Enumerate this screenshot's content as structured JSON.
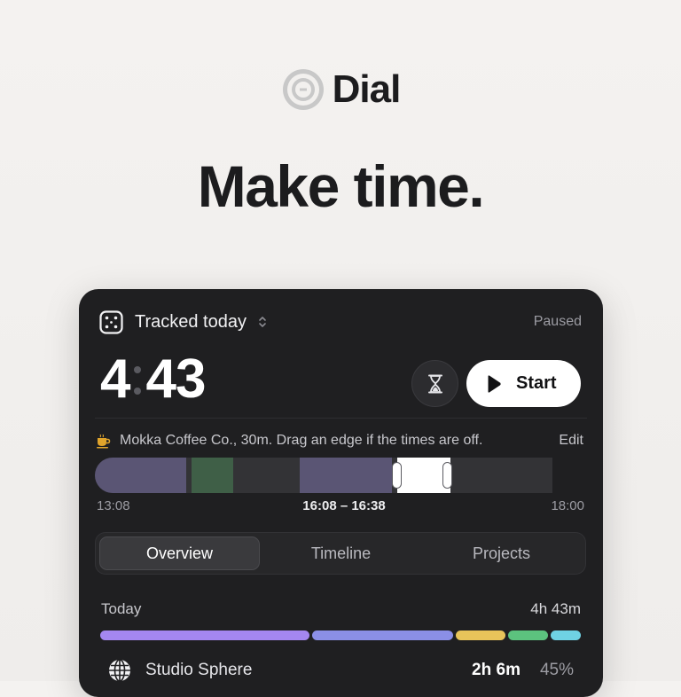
{
  "brand": {
    "name": "Dial"
  },
  "headline": "Make time.",
  "card": {
    "header": {
      "title": "Tracked today",
      "status": "Paused"
    },
    "timer": {
      "hours": "4",
      "minutes": "43"
    },
    "start_label": "Start",
    "entry": {
      "text": "Mokka Coffee Co., 30m. Drag an edge if the times are off.",
      "edit_label": "Edit"
    },
    "strip": {
      "start_time": "13:08",
      "selected_range": "16:08 – 16:38",
      "end_time": "18:00"
    },
    "tabs": [
      {
        "label": "Overview",
        "active": true
      },
      {
        "label": "Timeline",
        "active": false
      },
      {
        "label": "Projects",
        "active": false
      }
    ],
    "overview": {
      "today_label": "Today",
      "today_total": "4h 43m",
      "projects": [
        {
          "name": "Studio Sphere",
          "duration": "2h 6m",
          "percent": "45%"
        }
      ]
    }
  },
  "icons": {
    "brand": "dial-logo-icon",
    "tracker": "tracker-icon",
    "chevron": "chevron-updown-icon",
    "hourglass": "hourglass-icon",
    "play": "play-icon",
    "coffee": "coffee-icon",
    "project": "globe-icon"
  },
  "colors": {
    "card_bg": "#1f1f21",
    "purple_segment": "#5a5574",
    "green_segment": "#3f5f47",
    "dist_purple": "#a487f0",
    "dist_blue": "#8b8fe6",
    "dist_yellow": "#e8c45a",
    "dist_green": "#5cc27e",
    "dist_cyan": "#6fd2e4"
  }
}
